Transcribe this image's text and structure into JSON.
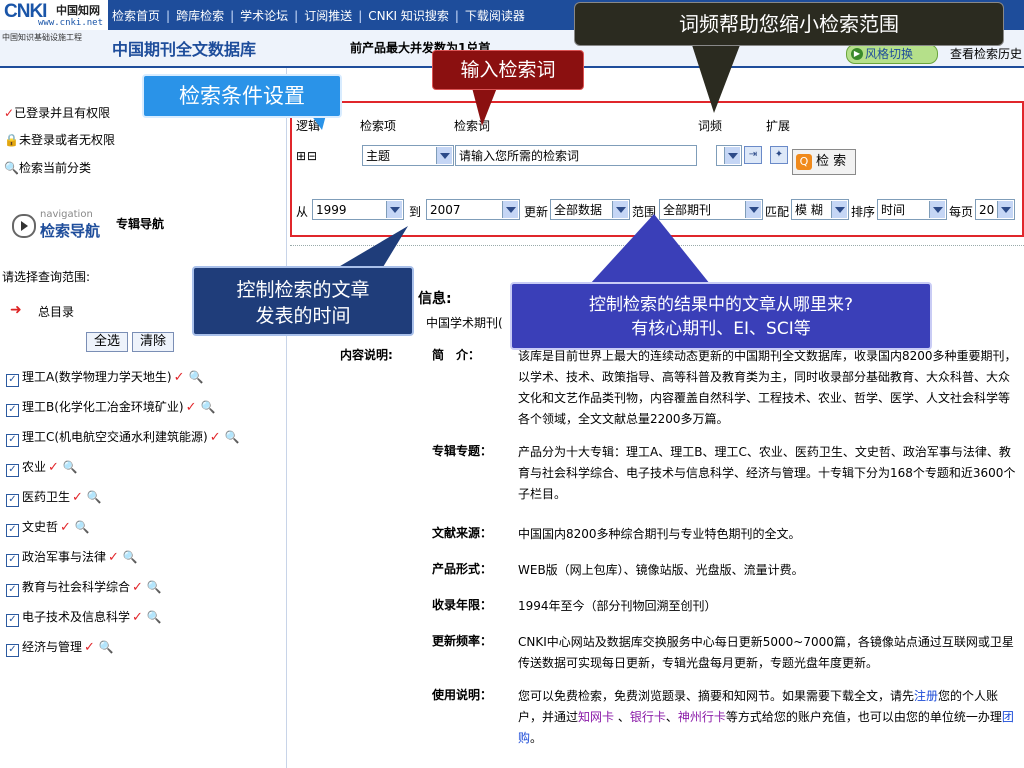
{
  "logo": {
    "cnki": "CNKI",
    "cn_name": "中国知网",
    "url": "www.cnki.net"
  },
  "topnav": {
    "items": [
      "检索首页",
      "跨库检索",
      "学术论坛",
      "订阅推送",
      "CNKI 知识搜索",
      "下载阅读器"
    ],
    "separator": "|"
  },
  "header": {
    "org": "中国知识基础设施工程",
    "db_title": "中国期刊全文数据库",
    "concurrent_text": "前产品最大并发数为1兑首",
    "style_switch": "风格切换",
    "history": "查看检索历史"
  },
  "sidebar": {
    "permissions": [
      {
        "icon": "check-icon",
        "label": "已登录并且有权限"
      },
      {
        "icon": "lock-icon",
        "label": "未登录或者无权限"
      },
      {
        "icon": "magnifier-icon",
        "label": "检索当前分类"
      }
    ],
    "nav_small": "navigation",
    "nav_big": "检索导航",
    "nav_zh": "专辑导航",
    "scope_label": "请选择查询范围:",
    "root_label": "总目录",
    "select_all": "全选",
    "clear": "清除",
    "categories": [
      "理工A(数学物理力学天地生)",
      "理工B(化学化工冶金环境矿业)",
      "理工C(机电航空交通水利建筑能源)",
      "农业",
      "医药卫生",
      "文史哲",
      "政治军事与法律",
      "教育与社会科学综合",
      "电子技术及信息科学",
      "经济与管理"
    ]
  },
  "search": {
    "logic_label": "逻辑",
    "item_label": "检索项",
    "term_label": "检索词",
    "freq_label": "词频",
    "expand_label": "扩展",
    "add_remove": "⊞⊟",
    "field_value": "主题",
    "term_placeholder": "请输入您所需的检索词",
    "search_button": "检 索",
    "from_label": "从",
    "from_year": "1999",
    "to_label": "到",
    "to_year": "2007",
    "update_label": "更新",
    "update_value": "全部数据",
    "range_label": "范围",
    "range_value": "全部期刊",
    "match_label": "匹配",
    "match_value": "模 糊",
    "sort_label": "排序",
    "sort_value": "时间",
    "per_page_label": "每页",
    "per_page_value": "20"
  },
  "content": {
    "info_title": "信息:",
    "db_name": "中国学术期刊(",
    "content_label": "内容说明:",
    "sections": [
      {
        "key": "简　介：",
        "value": "该库是目前世界上最大的连续动态更新的中国期刊全文数据库，收录国内8200多种重要期刊，以学术、技术、政策指导、高等科普及教育类为主，同时收录部分基础教育、大众科普、大众文化和文艺作品类刊物，内容覆盖自然科学、工程技术、农业、哲学、医学、人文社会科学等各个领域，全文文献总量2200多万篇。"
      },
      {
        "key": "专辑专题：",
        "value": "产品分为十大专辑：理工A、理工B、理工C、农业、医药卫生、文史哲、政治军事与法律、教育与社会科学综合、电子技术与信息科学、经济与管理。十专辑下分为168个专题和近3600个子栏目。"
      },
      {
        "key": "文献来源：",
        "value": "中国国内8200多种综合期刊与专业特色期刊的全文。"
      },
      {
        "key": "产品形式：",
        "value": "WEB版（网上包库）、镜像站版、光盘版、流量计费。"
      },
      {
        "key": "收录年限：",
        "value": "1994年至今（部分刊物回溯至创刊）"
      },
      {
        "key": "更新频率：",
        "value": "CNKI中心网站及数据库交换服务中心每日更新5000~7000篇，各镜像站点通过互联网或卫星传送数据可实现每日更新，专辑光盘每月更新，专题光盘年度更新。"
      }
    ],
    "usage_key": "使用说明：",
    "usage_parts": {
      "p1": "您可以免费检索，免费浏览题录、摘要和知网节。如果需要下载全文，请先",
      "register": "注册",
      "p2": "您的个人账户，并通过",
      "card1": "知网卡",
      "sep1": " 、",
      "card2": "银行卡",
      "sep2": "、",
      "card3": "神州行卡",
      "p3": "等方式给您的账户充值，也可以由您的单位统一办理",
      "group": "团购",
      "p4": "。"
    }
  },
  "callouts": {
    "freq": "词频帮助您缩小检索范围",
    "input": "输入检索词",
    "conditions": "检索条件设置",
    "time_line1": "控制检索的文章",
    "time_line2": "发表的时间",
    "source_line1": "控制检索的结果中的文章从哪里来?",
    "source_line2": "有核心期刊、EI、SCI等"
  },
  "colors": {
    "nav_blue": "#1e4d9b",
    "search_border": "#e0262b",
    "callout_dark": "#2b2b20",
    "callout_red": "#8b1010",
    "callout_blue": "#2a93e8",
    "callout_navy": "#1f3d7a",
    "callout_purple": "#3a3fb8"
  }
}
